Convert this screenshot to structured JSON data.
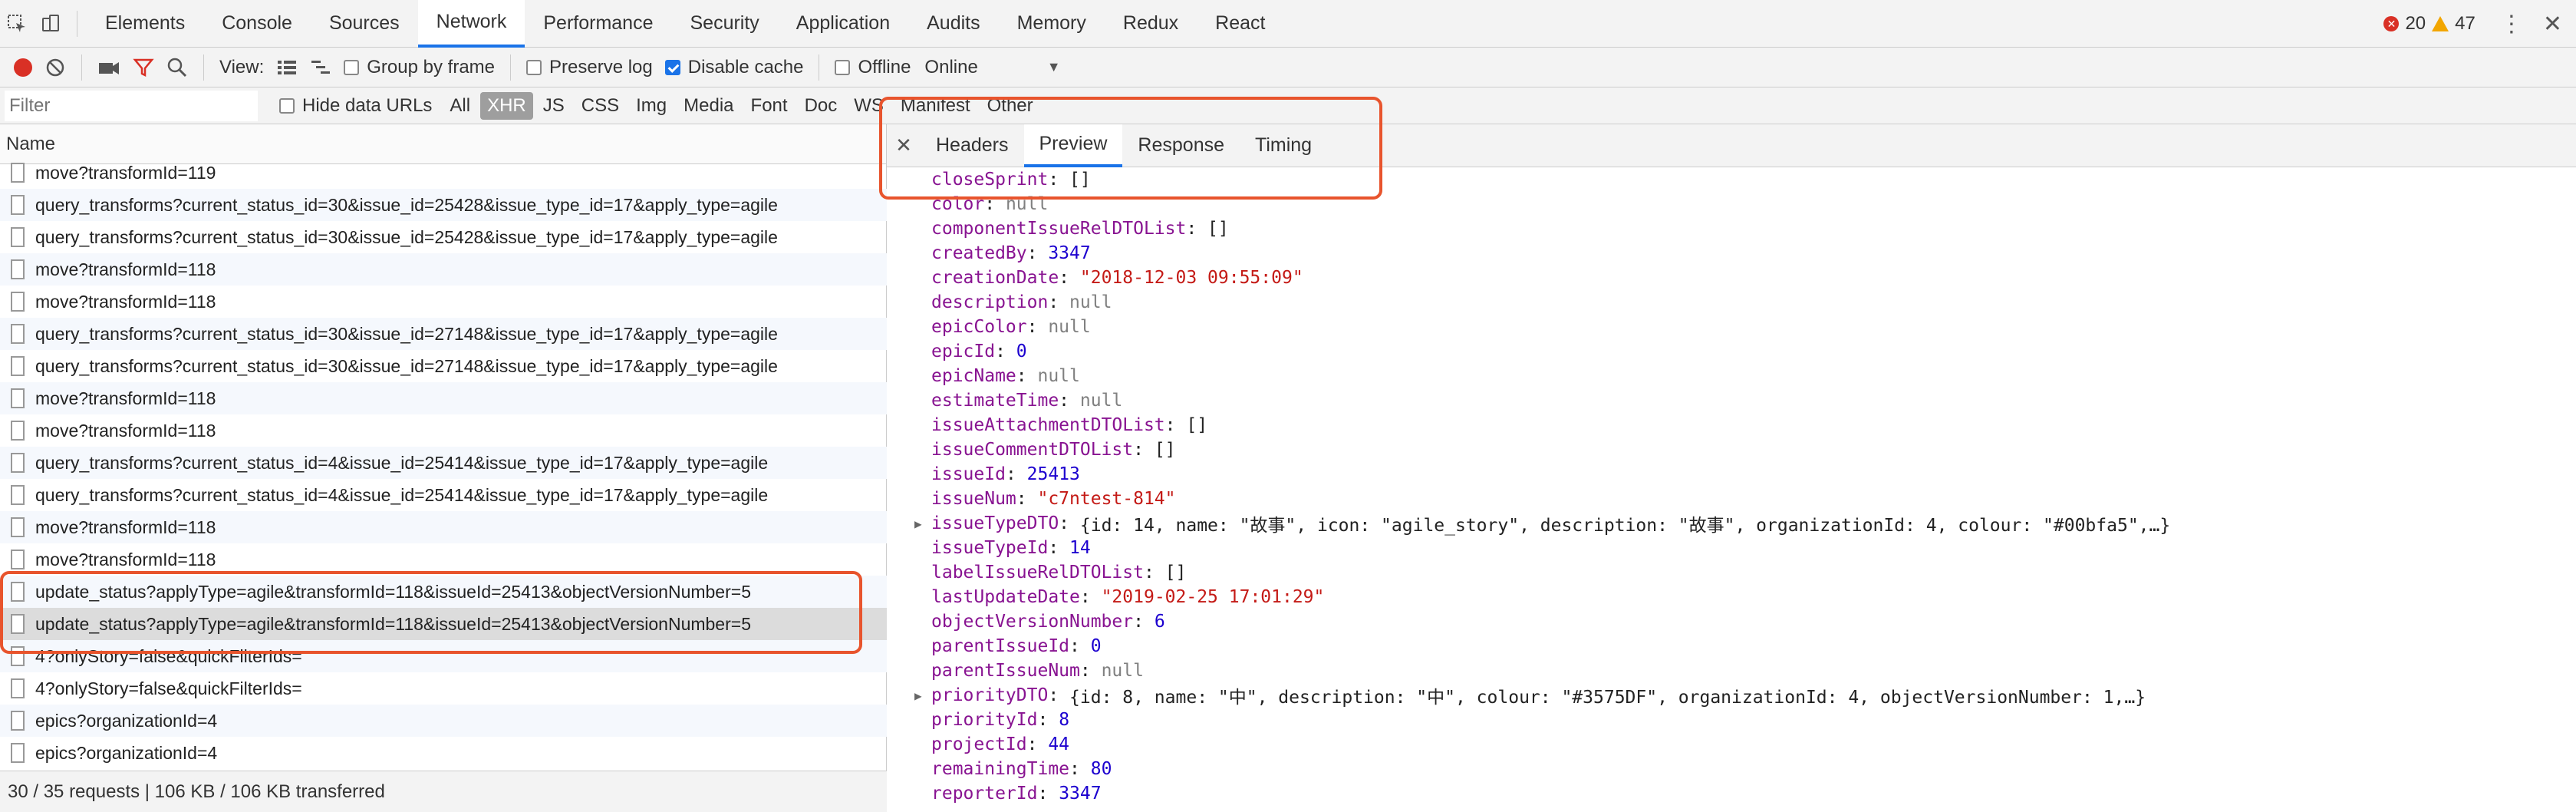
{
  "topbar": {
    "tabs": [
      "Elements",
      "Console",
      "Sources",
      "Network",
      "Performance",
      "Security",
      "Application",
      "Audits",
      "Memory",
      "Redux",
      "React"
    ],
    "active_tab": "Network",
    "error_count": "20",
    "warning_count": "47"
  },
  "toolbar": {
    "view_label": "View:",
    "group_by_frame": "Group by frame",
    "preserve_log": "Preserve log",
    "disable_cache": "Disable cache",
    "offline": "Offline",
    "throttle": "Online"
  },
  "filterbar": {
    "placeholder": "Filter",
    "hide_data_urls": "Hide data URLs",
    "types": [
      "All",
      "XHR",
      "JS",
      "CSS",
      "Img",
      "Media",
      "Font",
      "Doc",
      "WS",
      "Manifest",
      "Other"
    ],
    "active_type": "XHR"
  },
  "requests": {
    "header": "Name",
    "rows": [
      "move?transformId=119",
      "query_transforms?current_status_id=30&issue_id=25428&issue_type_id=17&apply_type=agile",
      "query_transforms?current_status_id=30&issue_id=25428&issue_type_id=17&apply_type=agile",
      "move?transformId=118",
      "move?transformId=118",
      "query_transforms?current_status_id=30&issue_id=27148&issue_type_id=17&apply_type=agile",
      "query_transforms?current_status_id=30&issue_id=27148&issue_type_id=17&apply_type=agile",
      "move?transformId=118",
      "move?transformId=118",
      "query_transforms?current_status_id=4&issue_id=25414&issue_type_id=17&apply_type=agile",
      "query_transforms?current_status_id=4&issue_id=25414&issue_type_id=17&apply_type=agile",
      "move?transformId=118",
      "move?transformId=118",
      "update_status?applyType=agile&transformId=118&issueId=25413&objectVersionNumber=5",
      "update_status?applyType=agile&transformId=118&issueId=25413&objectVersionNumber=5",
      "4?onlyStory=false&quickFilterIds=",
      "4?onlyStory=false&quickFilterIds=",
      "epics?organizationId=4",
      "epics?organizationId=4"
    ],
    "status": "30 / 35 requests | 106 KB / 106 KB transferred"
  },
  "detail": {
    "tabs": [
      "Headers",
      "Preview",
      "Response",
      "Timing"
    ],
    "active_tab": "Preview",
    "lines": [
      {
        "k": "closeSprint",
        "v": "[]",
        "t": "plain"
      },
      {
        "k": "color",
        "v": "null",
        "t": "nul"
      },
      {
        "k": "componentIssueRelDTOList",
        "v": "[]",
        "t": "plain"
      },
      {
        "k": "createdBy",
        "v": "3347",
        "t": "num"
      },
      {
        "k": "creationDate",
        "v": "\"2018-12-03 09:55:09\"",
        "t": "str"
      },
      {
        "k": "description",
        "v": "null",
        "t": "nul"
      },
      {
        "k": "epicColor",
        "v": "null",
        "t": "nul"
      },
      {
        "k": "epicId",
        "v": "0",
        "t": "num"
      },
      {
        "k": "epicName",
        "v": "null",
        "t": "nul"
      },
      {
        "k": "estimateTime",
        "v": "null",
        "t": "nul"
      },
      {
        "k": "issueAttachmentDTOList",
        "v": "[]",
        "t": "plain"
      },
      {
        "k": "issueCommentDTOList",
        "v": "[]",
        "t": "plain"
      },
      {
        "k": "issueId",
        "v": "25413",
        "t": "num"
      },
      {
        "k": "issueNum",
        "v": "\"c7ntest-814\"",
        "t": "str"
      },
      {
        "k": "issueTypeDTO",
        "v": "{id: 14, name: \"故事\", icon: \"agile_story\", description: \"故事\", organizationId: 4, colour: \"#00bfa5\",…}",
        "t": "plain",
        "obj": true
      },
      {
        "k": "issueTypeId",
        "v": "14",
        "t": "num"
      },
      {
        "k": "labelIssueRelDTOList",
        "v": "[]",
        "t": "plain"
      },
      {
        "k": "lastUpdateDate",
        "v": "\"2019-02-25 17:01:29\"",
        "t": "str"
      },
      {
        "k": "objectVersionNumber",
        "v": "6",
        "t": "num"
      },
      {
        "k": "parentIssueId",
        "v": "0",
        "t": "num"
      },
      {
        "k": "parentIssueNum",
        "v": "null",
        "t": "nul"
      },
      {
        "k": "priorityDTO",
        "v": "{id: 8, name: \"中\", description: \"中\", colour: \"#3575DF\", organizationId: 4, objectVersionNumber: 1,…}",
        "t": "plain",
        "obj": true
      },
      {
        "k": "priorityId",
        "v": "8",
        "t": "num"
      },
      {
        "k": "projectId",
        "v": "44",
        "t": "num"
      },
      {
        "k": "remainingTime",
        "v": "80",
        "t": "num"
      },
      {
        "k": "reporterId",
        "v": "3347",
        "t": "num"
      }
    ]
  }
}
